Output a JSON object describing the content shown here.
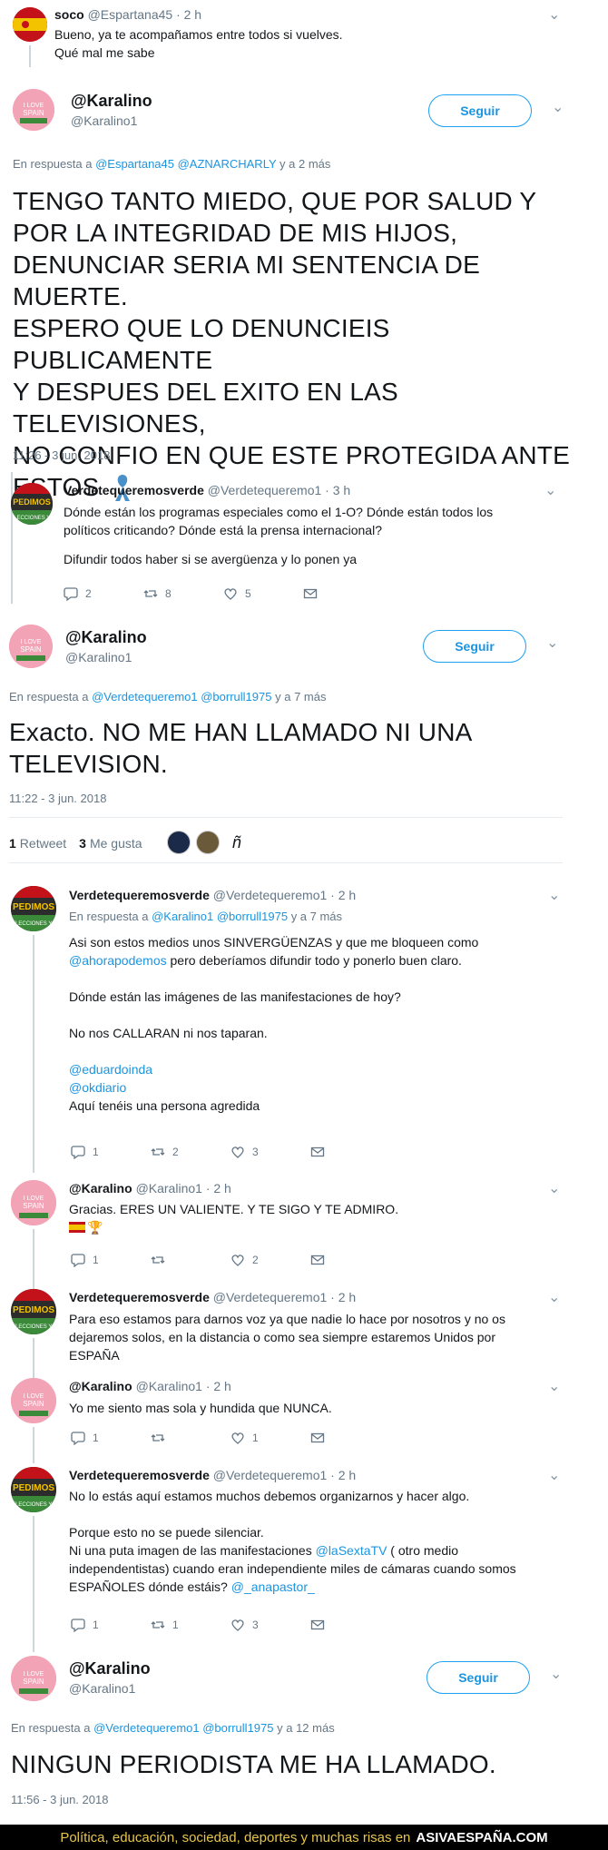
{
  "t0": {
    "name": "soco",
    "handle": "@Espartana45",
    "time": "· 2 h",
    "line1": "Bueno, ya te acompañamos entre todos si vuelves.",
    "line2": "Qué mal me sabe"
  },
  "main1": {
    "name": "@Karalino",
    "handle": "@Karalino1",
    "follow": "Seguir",
    "reply_prefix": "En respuesta a",
    "reply_to": "@Espartana45 @AZNARCHARLY",
    "reply_suffix": "y a 2 más",
    "lines": [
      "TENGO TANTO MIEDO, QUE POR SALUD Y",
      "POR LA INTEGRIDAD DE MIS HIJOS,",
      "DENUNCIAR SERIA MI SENTENCIA DE",
      "MUERTE.",
      "ESPERO QUE LO DENUNCIEIS PUBLICAMENTE",
      "Y DESPUES DEL EXITO EN LAS TELEVISIONES,",
      "NO CONFIO EN QUE ESTE PROTEGIDA ANTE",
      "ESTOS"
    ],
    "timestamp": "11:26 - 3 jun. 2018"
  },
  "t1": {
    "name": "Verdetequeremosverde",
    "handle": "@Verdetequeremo1",
    "time": "· 3 h",
    "line1": "Dónde están los programas especiales como el 1-O? Dónde están todos los",
    "line2": "políticos criticando? Dónde está la prensa internacional?",
    "line3": "Difundir todos haber si se avergüenza y lo ponen ya",
    "replies": "2",
    "retweets": "8",
    "likes": "5"
  },
  "main2": {
    "name": "@Karalino",
    "handle": "@Karalino1",
    "follow": "Seguir",
    "reply_prefix": "En respuesta a",
    "reply_to": "@Verdetequeremo1 @borrull1975",
    "reply_suffix": "y a 7 más",
    "line1": "Exacto. NO ME HAN LLAMADO NI UNA",
    "line2": "TELEVISION.",
    "timestamp": "11:22 - 3 jun. 2018",
    "retweets_count": "1",
    "retweets_label": "Retweet",
    "likes_count": "3",
    "likes_label": "Me gusta",
    "liker_glyph": "ñ"
  },
  "r1": {
    "name": "Verdetequeremosverde",
    "handle": "@Verdetequeremo1",
    "time": "· 2 h",
    "reply_prefix": "En respuesta a",
    "reply_to": "@Karalino1 @borrull1975",
    "reply_suffix": "y a 7 más",
    "line1": "Asi son estos medios unos SINVERGÜENZAS y que me bloqueen como",
    "mention1": "@ahorapodemos",
    "line2": " pero deberíamos difundir todo y ponerlo buen claro.",
    "line3": "Dónde están las imágenes de las manifestaciones de hoy?",
    "line4": "No nos CALLARAN ni nos taparan.",
    "mention2": "@eduardoinda",
    "mention3": "@okdiario",
    "line5": "Aquí tenéis una persona agredida",
    "replies": "1",
    "retweets": "2",
    "likes": "3"
  },
  "r2": {
    "name": "@Karalino",
    "handle": "@Karalino1",
    "time": "· 2 h",
    "line1": "Gracias. ERES UN VALIENTE. Y TE SIGO Y TE ADMIRO.",
    "emoji": "🏆",
    "replies": "1",
    "likes": "2"
  },
  "r3": {
    "name": "Verdetequeremosverde",
    "handle": "@Verdetequeremo1",
    "time": "· 2 h",
    "line1": "Para eso estamos para darnos voz ya que nadie lo hace por nosotros y no os",
    "line2": "dejaremos solos, en la distancia o como sea siempre estaremos Unidos por",
    "line3": "ESPAÑA"
  },
  "r4": {
    "name": "@Karalino",
    "handle": "@Karalino1",
    "time": "· 2 h",
    "line1": "Yo me siento mas sola y hundida que NUNCA.",
    "replies": "1",
    "likes": "1"
  },
  "r5": {
    "name": "Verdetequeremosverde",
    "handle": "@Verdetequeremo1",
    "time": "· 2 h",
    "line1": "No lo estás aquí estamos muchos debemos organizarnos y hacer algo.",
    "line2": "Porque esto no se puede silenciar.",
    "line3a": "Ni una puta imagen de las manifestaciones ",
    "mention1": "@laSextaTV",
    "line3b": " ( otro medio",
    "line4": "independentistas) cuando eran independiente miles de cámaras cuando somos",
    "line5a": "ESPAÑOLES dónde estáis? ",
    "mention2": "@_anapastor_",
    "replies": "1",
    "retweets": "1",
    "likes": "3"
  },
  "main3": {
    "name": "@Karalino",
    "handle": "@Karalino1",
    "follow": "Seguir",
    "reply_prefix": "En respuesta a",
    "reply_to": "@Verdetequeremo1 @borrull1975",
    "reply_suffix": "y a 12 más",
    "line1": "NINGUN PERIODISTA ME HA LLAMADO.",
    "timestamp": "11:56 - 3 jun. 2018"
  },
  "footer": {
    "text": "Política, educación, sociedad, deportes y muchas risas en",
    "brand": "ASIVAESPAÑA.COM"
  },
  "avatars": {
    "pink_text": "I LOVE SPAIN #Karalino",
    "green_text": "PEDIMOS ELECCIONES YA"
  },
  "colors": {
    "link": "#1b95e0",
    "footer_text": "#e6c64a"
  }
}
